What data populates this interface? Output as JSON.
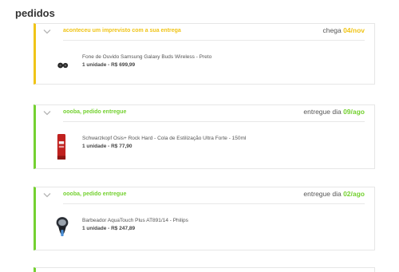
{
  "page": {
    "title": "pedidos"
  },
  "colors": {
    "warning": "#f0c417",
    "success": "#74d130",
    "text": "#333333"
  },
  "orders": [
    {
      "status": "aconteceu um imprevisto com a sua entrega",
      "status_kind": "warning",
      "date_prefix": "chega",
      "date": "04/nov",
      "product_name": "Fone de Ouvido Samsung Galaxy Buds Wireless - Preto",
      "product_info": "1 unidade - R$ 699,99",
      "icon": "earbuds-icon"
    },
    {
      "status": "oooba, pedido entregue",
      "status_kind": "success",
      "date_prefix": "entregue dia",
      "date": "09/ago",
      "product_name": "Schwarzkopf Osis+ Rock Hard - Cola de Estilização Ultra Forte - 150ml",
      "product_info": "1 unidade - R$ 77,90",
      "icon": "hair-glue-tube-icon"
    },
    {
      "status": "oooba, pedido entregue",
      "status_kind": "success",
      "date_prefix": "entregue dia",
      "date": "02/ago",
      "product_name": "Barbeador AquaTouch Plus AT891/14 - Philips",
      "product_info": "1 unidade - R$ 247,89",
      "icon": "shaver-icon"
    }
  ]
}
